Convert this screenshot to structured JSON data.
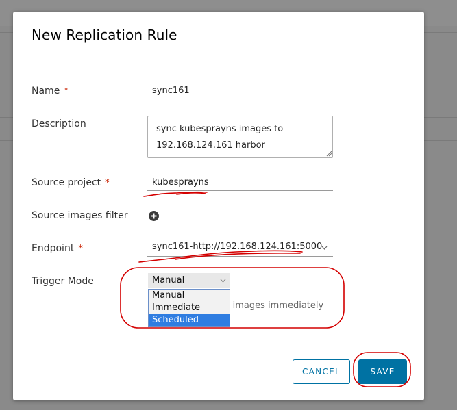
{
  "dialog": {
    "title": "New Replication Rule",
    "name_label": "Name",
    "name_value": "sync161",
    "description_label": "Description",
    "description_value": "sync kubesprayns images to\n192.168.124.161 harbor",
    "source_project_label": "Source project",
    "source_project_value": "kubesprayns",
    "source_filter_label": "Source images filter",
    "endpoint_label": "Endpoint",
    "endpoint_value": "sync161-http://192.168.124.161:5000",
    "trigger_label": "Trigger Mode",
    "trigger_value": "Manual",
    "trigger_options": [
      "Manual",
      "Immediate",
      "Scheduled"
    ],
    "trigger_highlighted": "Scheduled",
    "trigger_hint_partial": "ng images immediately",
    "required_mark": "*",
    "cancel_label": "CANCEL",
    "save_label": "SAVE"
  },
  "colors": {
    "primary": "#0072a3",
    "required": "#c92100",
    "annotation": "#d40000",
    "highlight": "#2f7de1"
  }
}
